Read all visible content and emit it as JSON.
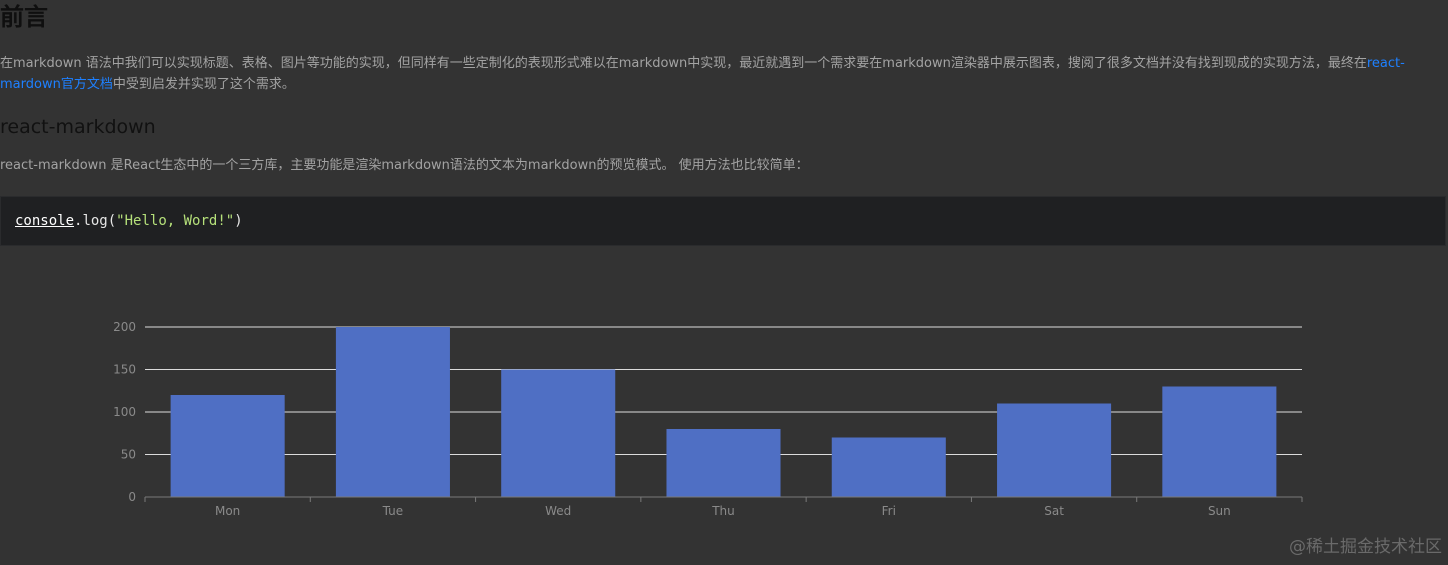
{
  "article": {
    "heading": "前言",
    "intro_before_link": "在markdown 语法中我们可以实现标题、表格、图片等功能的实现，但同样有一些定制化的表现形式难以在markdown中实现，最近就遇到一个需求要在markdown渲染器中展示图表，搜阅了很多文档并没有找到现成的实现方法，最终在",
    "intro_link": "react-mardown官方文档",
    "intro_after_link": "中受到启发并实现了这个需求。",
    "subheading": "react-markdown",
    "description": "react-markdown 是React生态中的一个三方库，主要功能是渲染markdown语法的文本为markdown的预览模式。 使用方法也比较简单："
  },
  "code": {
    "object": "console",
    "call": ".log(",
    "string": "\"Hello, Word!\"",
    "close": ")"
  },
  "chart_data": {
    "type": "bar",
    "categories": [
      "Mon",
      "Tue",
      "Wed",
      "Thu",
      "Fri",
      "Sat",
      "Sun"
    ],
    "values": [
      120,
      200,
      150,
      80,
      70,
      110,
      130
    ],
    "ylim": [
      0,
      200
    ],
    "yticks": [
      0,
      50,
      100,
      150,
      200
    ],
    "grid": true,
    "bar_color": "#4f6fc4"
  },
  "watermark": "@稀土掘金技术社区",
  "colors": {
    "background": "#333333",
    "link": "#1e80ff",
    "code_bg": "#1f2022",
    "string": "#b5e07a"
  }
}
